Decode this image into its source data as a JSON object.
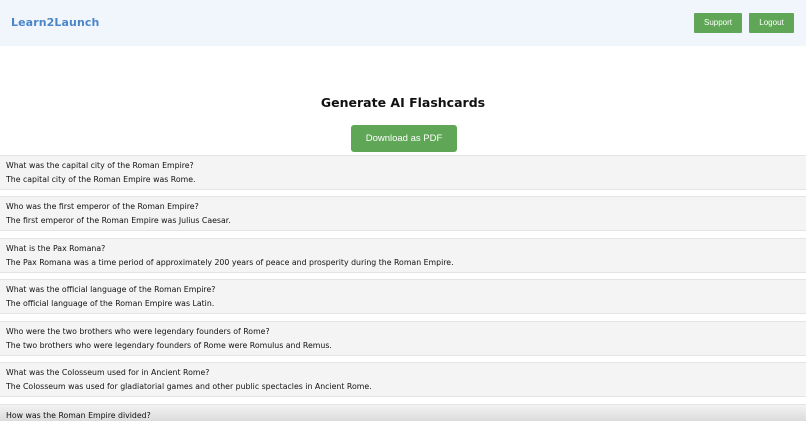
{
  "navbar": {
    "brand": "Learn2Launch",
    "support_label": "Support",
    "logout_label": "Logout"
  },
  "main": {
    "title": "Generate AI Flashcards",
    "download_label": "Download as PDF"
  },
  "flashcards": [
    {
      "question": "What was the capital city of the Roman Empire?",
      "answer": "The capital city of the Roman Empire was Rome."
    },
    {
      "question": "Who was the first emperor of the Roman Empire?",
      "answer": "The first emperor of the Roman Empire was Julius Caesar."
    },
    {
      "question": "What is the Pax Romana?",
      "answer": "The Pax Romana was a time period of approximately 200 years of peace and prosperity during the Roman Empire."
    },
    {
      "question": "What was the official language of the Roman Empire?",
      "answer": "The official language of the Roman Empire was Latin."
    },
    {
      "question": "Who were the two brothers who were legendary founders of Rome?",
      "answer": "The two brothers who were legendary founders of Rome were Romulus and Remus."
    },
    {
      "question": "What was the Colosseum used for in Ancient Rome?",
      "answer": "The Colosseum was used for gladiatorial games and other public spectacles in Ancient Rome."
    },
    {
      "question": "How was the Roman Empire divided?",
      "answer": ""
    }
  ],
  "colors": {
    "accent_green": "#5fa757",
    "brand_blue": "#4a86c8",
    "navbar_bg": "#f1f6fc",
    "card_bg": "#f4f4f4"
  }
}
